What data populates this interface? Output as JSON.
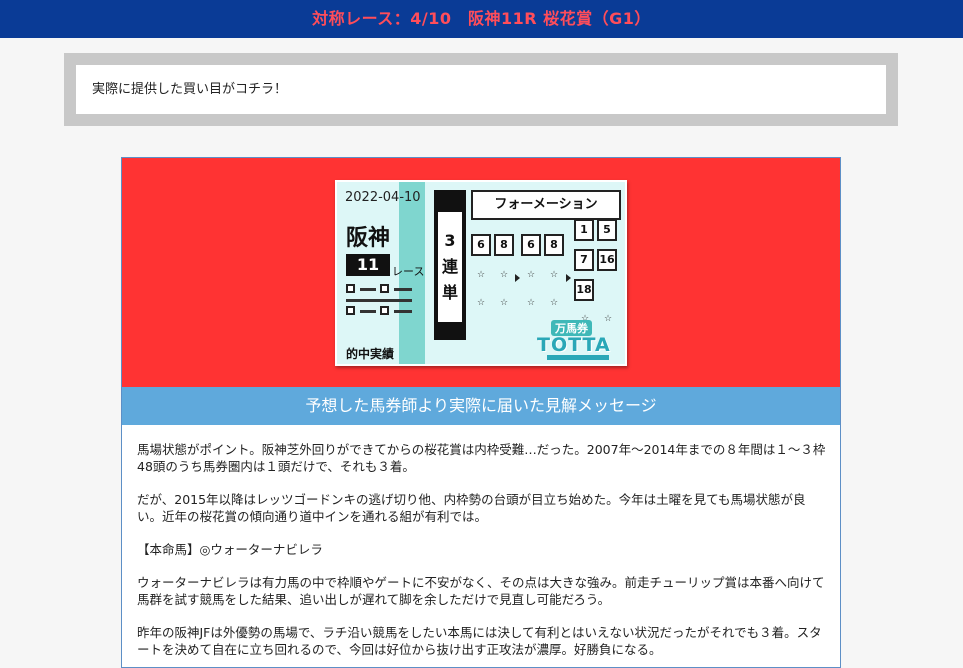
{
  "header": {
    "title": "対称レース：4/10　阪神11R 桜花賞（G1）"
  },
  "notice": {
    "text": "実際に提供した買い目がコチラ！"
  },
  "ticket": {
    "date": "2022-04-10",
    "venue": "阪神",
    "race_number": "11",
    "race_suffix": "レース",
    "bet_type_chars": [
      "3",
      "連",
      "単"
    ],
    "method": "フォーメーション",
    "col1": [
      "6",
      "8"
    ],
    "col2": [
      "6",
      "8"
    ],
    "col3": [
      "1",
      "5",
      "7",
      "16",
      "18"
    ],
    "footer": "的中実績",
    "logo_top": "万馬券",
    "logo_main": "TOTTA",
    "qr_label": "TOTTA!"
  },
  "band": {
    "title": "予想した馬券師より実際に届いた見解メッセージ"
  },
  "message": {
    "paragraphs": [
      "馬場状態がポイント。阪神芝外回りができてからの桜花賞は内枠受難…だった。2007年～2014年までの８年間は１～３枠48頭のうち馬券圏内は１頭だけで、それも３着。",
      "だが、2015年以降はレッツゴードンキの逃げ切り他、内枠勢の台頭が目立ち始めた。今年は土曜を見ても馬場状態が良い。近年の桜花賞の傾向通り道中インを通れる組が有利では。",
      "【本命馬】◎ウォーターナビレラ",
      "ウォーターナビレラは有力馬の中で枠順やゲートに不安がなく、その点は大きな強み。前走チューリップ賞は本番へ向けて馬群を試す競馬をした結果、追い出しが遅れて脚を余しただけで見直し可能だろう。",
      "昨年の阪神JFは外優勢の馬場で、ラチ沿い競馬をしたい本馬には決して有利とはいえない状況だったがそれでも３着。スタートを決めて自在に立ち回れるので、今回は好位から抜け出す正攻法が濃厚。好勝負になる。"
    ]
  },
  "colors": {
    "header_bg": "#0a3b96",
    "header_text": "#ff4d5a",
    "card_top": "#ff3333",
    "band": "#5fa9dc"
  }
}
